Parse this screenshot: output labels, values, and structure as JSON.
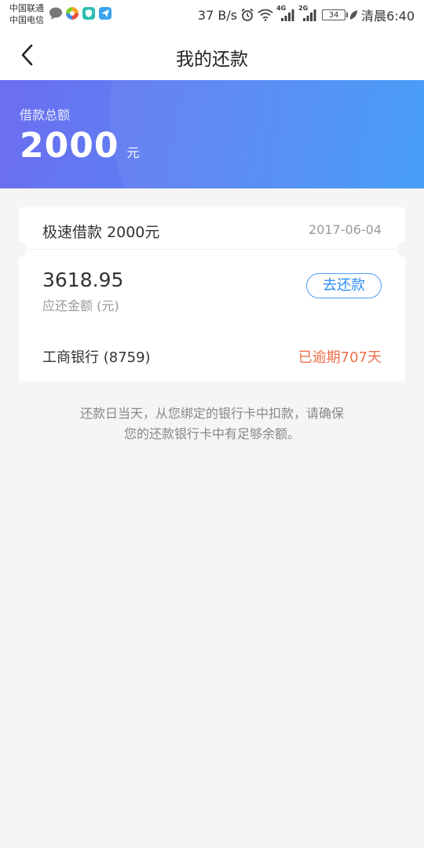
{
  "status_bar": {
    "carrier_1": "中国联通",
    "carrier_2": "中国电信",
    "network_speed": "37 B/s",
    "signal_1_label": "4G",
    "signal_2_label": "2G",
    "battery": "34",
    "time": "清晨6:40"
  },
  "nav": {
    "title": "我的还款"
  },
  "banner": {
    "label": "借款总额",
    "amount": "2000",
    "unit": "元"
  },
  "loan": {
    "name": "极速借款 2000元",
    "date": "2017-06-04",
    "due_amount": "3618.95",
    "due_label": "应还金额 (元)",
    "repay_button": "去还款",
    "bank": "工商银行 (8759)",
    "overdue": "已逾期707天"
  },
  "footnote": {
    "line1": "还款日当天，从您绑定的银行卡中扣款，请确保",
    "line2": "您的还款银行卡中有足够余额。"
  },
  "colors": {
    "banner_start": "#6c6ef0",
    "banner_end": "#3f9af8",
    "accent_blue": "#2f8ef4",
    "overdue_red": "#f0704b"
  }
}
